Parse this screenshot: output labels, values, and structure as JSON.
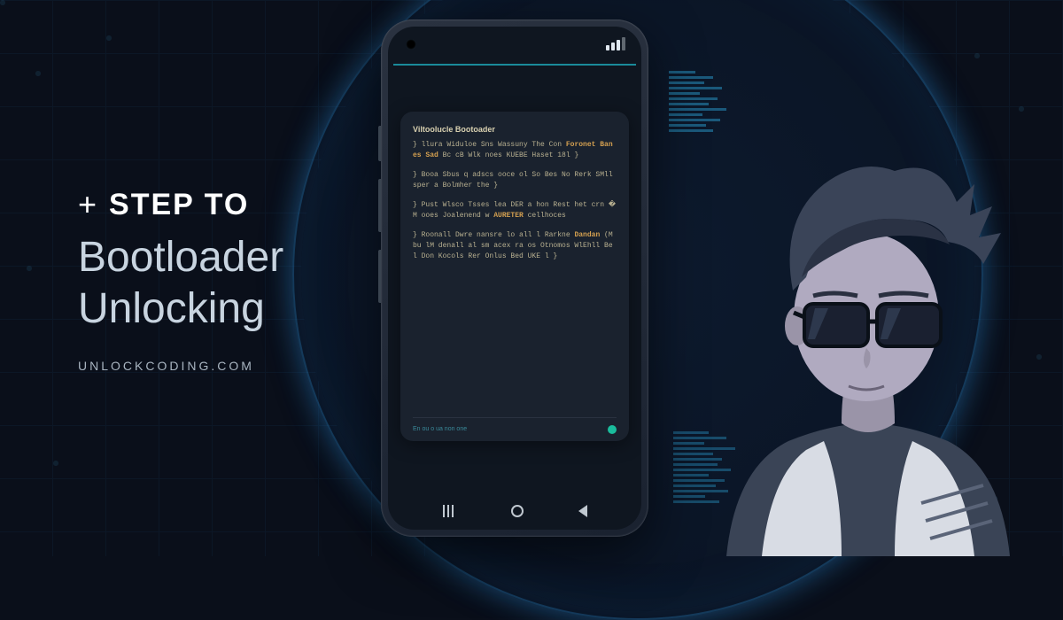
{
  "text": {
    "step_to": "STEP TO",
    "plus": "+",
    "title_line1": "Bootloader",
    "title_line2": "Unlocking",
    "site": "UNLOCKCODING.COM"
  },
  "phone": {
    "card_title": "Viltoolucle Bootoader",
    "para1_a": "}\nllura Widuloe Sns Wassuny  The  Con",
    "para1_hl": "Foronet Banes Sad",
    "para1_b": "  Bc cB Wlk  noes KUEBE Haset  18l   }",
    "para2": "}\nBooa Sbus q  adscs ooce  ol  So\nBes No Rerk SMll sper a   Bolmher\nthe   }",
    "para3_a": "} Pust Wlsco Tsses lea DER a\nhon Rest het crn �  M   ooes\nJoalenend w ",
    "para3_hl": "AURETER",
    "para3_b": " cellhoces",
    "para4_a": "}\nRoonall Dwre nansre lo all l\nRarkne ",
    "para4_hl": "Dandan",
    "para4_b": " (M    bu lM\ndenall al sm acex ra os Otnomos\nWlEhll Bel Don Kocols Rer Onlus\nBed UKE l    }",
    "footer_text": "En ou o ua non one",
    "signal_level": 3
  },
  "colors": {
    "accent_teal": "#1abc9c",
    "accent_blue": "#2a9acc",
    "bg": "#0a0f1a"
  }
}
